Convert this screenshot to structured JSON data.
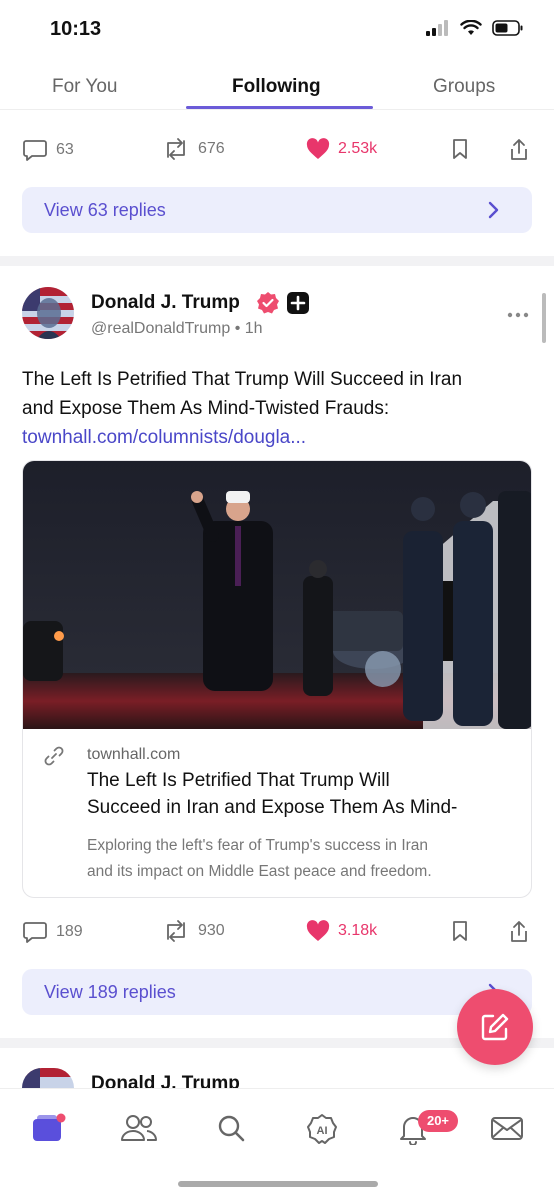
{
  "status_bar": {
    "time": "10:13",
    "battery_percent": 55
  },
  "tabs": [
    {
      "label": "For You",
      "active": false
    },
    {
      "label": "Following",
      "active": true
    },
    {
      "label": "Groups",
      "active": false
    }
  ],
  "prev_post": {
    "replies": "63",
    "reposts": "676",
    "likes": "2.53k",
    "view_replies_label": "View 63 replies"
  },
  "post": {
    "author": "Donald J. Trump",
    "handle": "@realDonaldTrump • 1h",
    "more_icon": "more-dots-icon",
    "text_lines": [
      "The Left Is Petrified That Trump Will Succeed in Iran",
      "and Expose Them As Mind-Twisted Frauds:"
    ],
    "link": "townhall.com/columnists/dougla...",
    "card": {
      "domain": "townhall.com",
      "title_lines": [
        "The Left Is Petrified That Trump Will",
        "Succeed in Iran and Expose Them As Mind-"
      ],
      "description_lines": [
        "Exploring the left's fear of Trump's success in Iran",
        "and its impact on Middle East peace and freedom."
      ]
    },
    "replies": "189",
    "reposts": "930",
    "likes": "3.18k",
    "view_replies_label": "View 189 replies"
  },
  "next_post": {
    "author": "Donald J. Trump"
  },
  "bottom_nav": {
    "items": [
      "home-icon",
      "people-icon",
      "search-icon",
      "ai-icon",
      "bell-icon",
      "mail-icon"
    ],
    "notification_badge": "20+"
  },
  "colors": {
    "accent": "#6b5bd8",
    "like": "#e8366b",
    "fab": "#ee4d6f",
    "link": "#4a47c8",
    "replies_bg": "#eceefc"
  }
}
